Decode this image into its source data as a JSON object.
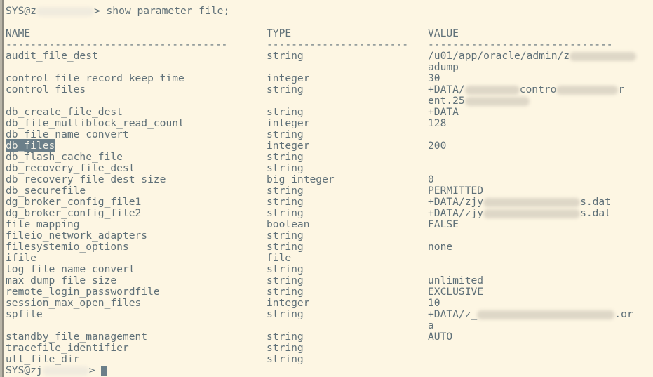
{
  "terminal": {
    "background_color": "#fdf6e3",
    "text_color": "#5f7078",
    "selection_bg_color": "#6b7f89",
    "selection_fg_color": "#f2efe4",
    "cursor_color": "#6b7f89"
  },
  "prompt_line": {
    "prefix": "SYS@z",
    "suffix": "> ",
    "command": "show parameter file;"
  },
  "headers": {
    "name": "NAME",
    "type": "TYPE",
    "value": "VALUE",
    "name_rule": "------------------------------------",
    "type_rule": "-----------------------",
    "value_rule": "------------------------------"
  },
  "rows": [
    {
      "name": "audit_file_dest",
      "type": "string",
      "value": "/u01/app/oracle/admin/z",
      "value_redacted": true,
      "value_cont": "adump"
    },
    {
      "name": "control_file_record_keep_time",
      "type": "integer",
      "value": "30"
    },
    {
      "name": "control_files",
      "type": "string",
      "value": "+DATA/",
      "value_mid": "contro",
      "value_tail": "r",
      "value_cont": "ent.25"
    },
    {
      "name": "db_create_file_dest",
      "type": "string",
      "value": "+DATA"
    },
    {
      "name": "db_file_multiblock_read_count",
      "type": "integer",
      "value": "128"
    },
    {
      "name": "db_file_name_convert",
      "type": "string",
      "value": ""
    },
    {
      "name": "db_files",
      "type": "integer",
      "value": "200",
      "selected": true
    },
    {
      "name": "db_flash_cache_file",
      "type": "string",
      "value": ""
    },
    {
      "name": "db_recovery_file_dest",
      "type": "string",
      "value": ""
    },
    {
      "name": "db_recovery_file_dest_size",
      "type": "big integer",
      "value": "0"
    },
    {
      "name": "db_securefile",
      "type": "string",
      "value": "PERMITTED"
    },
    {
      "name": "dg_broker_config_file1",
      "type": "string",
      "value": "+DATA/zjy",
      "value_tail": "s.dat"
    },
    {
      "name": "dg_broker_config_file2",
      "type": "string",
      "value": "+DATA/zjy",
      "value_tail": "s.dat"
    },
    {
      "name": "file_mapping",
      "type": "boolean",
      "value": "FALSE"
    },
    {
      "name": "fileio_network_adapters",
      "type": "string",
      "value": ""
    },
    {
      "name": "filesystemio_options",
      "type": "string",
      "value": "none"
    },
    {
      "name": "ifile",
      "type": "file",
      "value": ""
    },
    {
      "name": "log_file_name_convert",
      "type": "string",
      "value": ""
    },
    {
      "name": "max_dump_file_size",
      "type": "string",
      "value": "unlimited"
    },
    {
      "name": "remote_login_passwordfile",
      "type": "string",
      "value": "EXCLUSIVE"
    },
    {
      "name": "session_max_open_files",
      "type": "integer",
      "value": "10"
    },
    {
      "name": "spfile",
      "type": "string",
      "value": "+DATA/z_",
      "value_tail": ".or",
      "value_cont": "a"
    },
    {
      "name": "standby_file_management",
      "type": "string",
      "value": "AUTO"
    },
    {
      "name": "tracefile_identifier",
      "type": "string",
      "value": ""
    },
    {
      "name": "utl_file_dir",
      "type": "string",
      "value": ""
    }
  ],
  "final_prompt": {
    "prefix": "SYS@zj",
    "suffix": "> "
  }
}
